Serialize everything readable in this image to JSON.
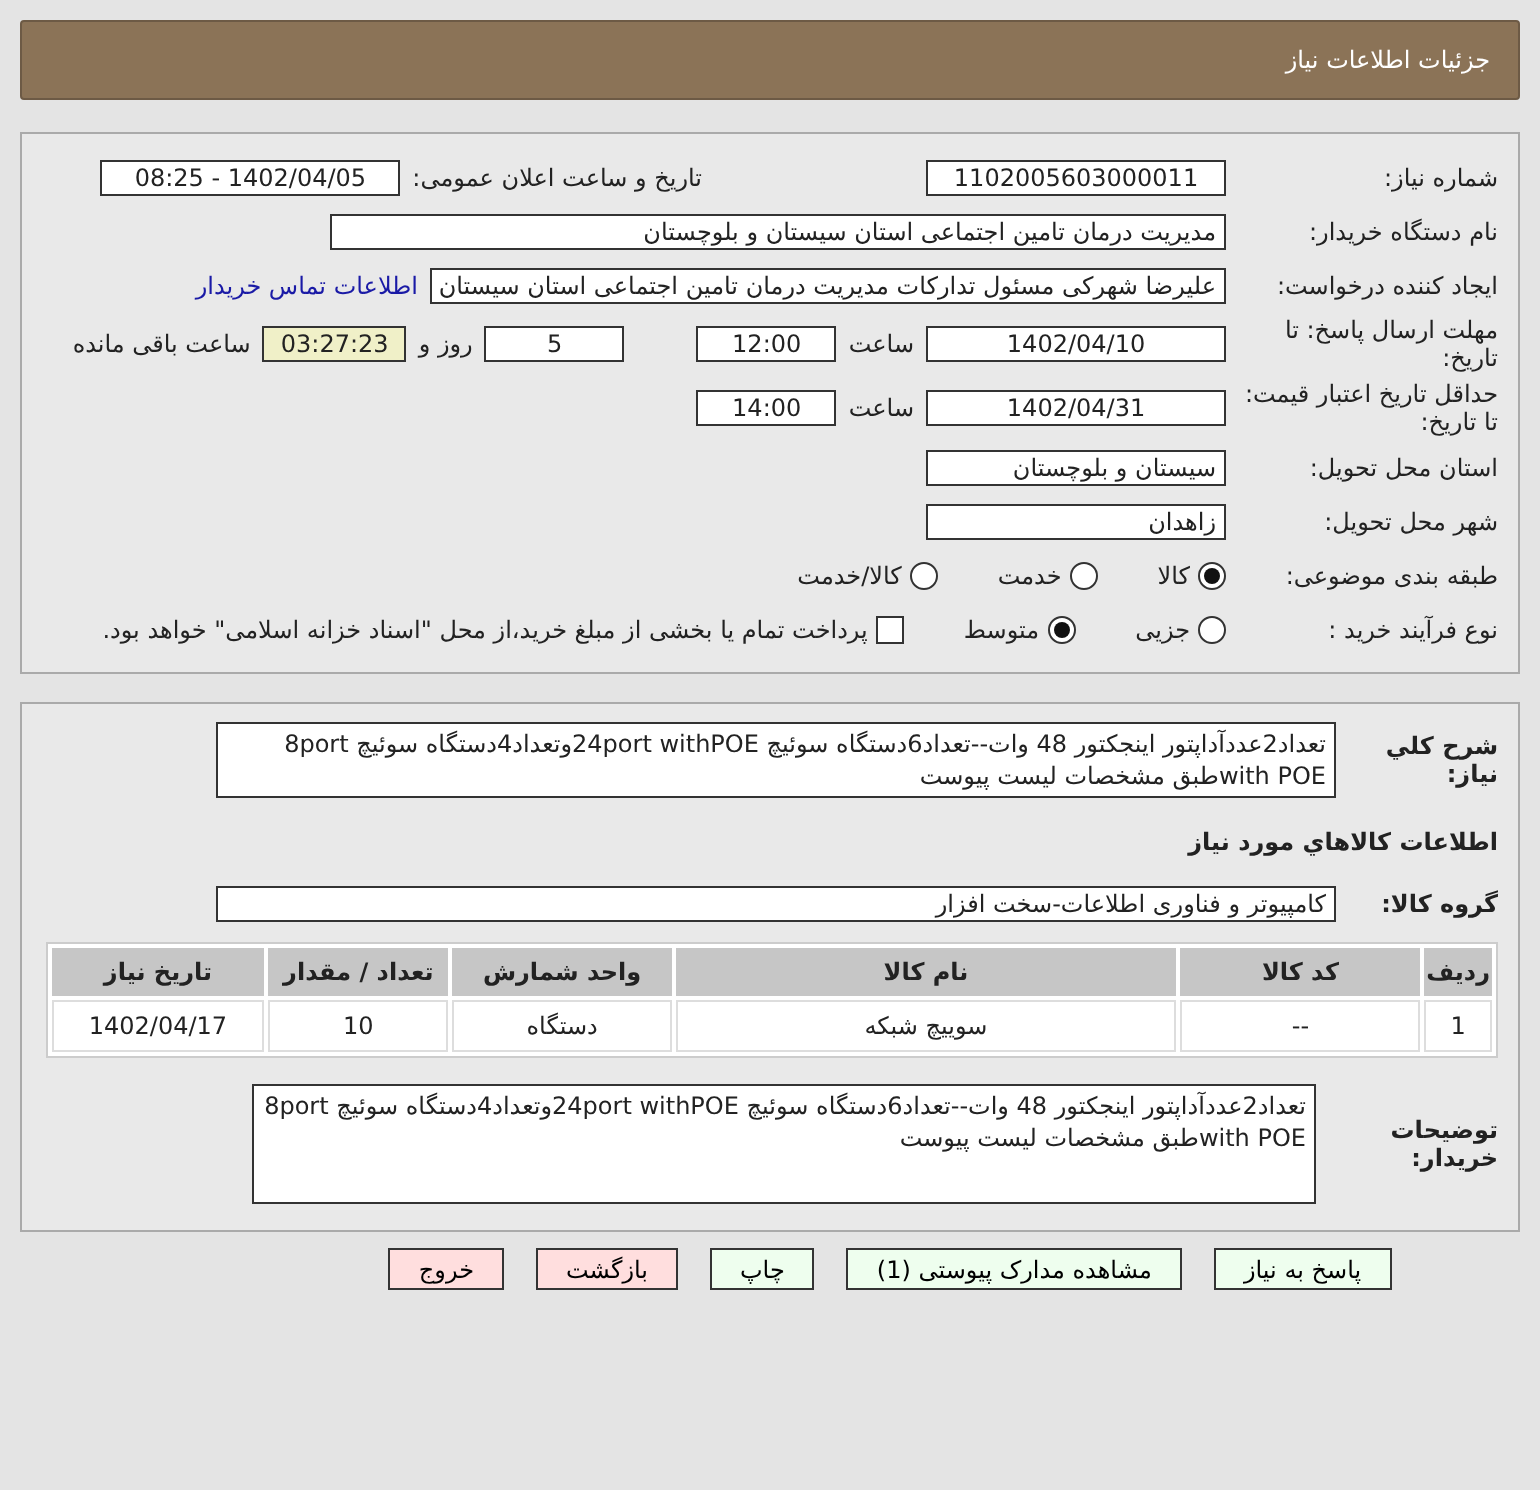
{
  "header": {
    "title": "جزئیات اطلاعات نیاز"
  },
  "need_number": {
    "label": "شماره نیاز:",
    "value": "1102005603000011"
  },
  "announce": {
    "label": "تاریخ و ساعت اعلان عمومی:",
    "value": "1402/04/05 - 08:25"
  },
  "buyer_org": {
    "label": "نام دستگاه خریدار:",
    "value": "مدیریت درمان تامین اجتماعی استان سیستان و بلوچستان"
  },
  "requester": {
    "label": "ایجاد کننده درخواست:",
    "value": "علیرضا شهرکی مسئول تدارکات مدیریت درمان تامین اجتماعی استان سیستان",
    "link": "اطلاعات تماس خریدار"
  },
  "deadline": {
    "label": "مهلت ارسال پاسخ: تا تاریخ:",
    "date": "1402/04/10",
    "time_label": "ساعت",
    "time": "12:00",
    "days": "5",
    "days_label": "روز و",
    "remaining": "03:27:23",
    "remaining_label": "ساعت باقی مانده"
  },
  "validity": {
    "label": "حداقل تاریخ اعتبار قیمت: تا تاریخ:",
    "date": "1402/04/31",
    "time_label": "ساعت",
    "time": "14:00"
  },
  "province": {
    "label": "استان محل تحویل:",
    "value": "سیستان و بلوچستان"
  },
  "city": {
    "label": "شهر محل تحویل:",
    "value": "زاهدان"
  },
  "category": {
    "label": "طبقه بندی موضوعی:",
    "options": [
      {
        "label": "کالا",
        "selected": true
      },
      {
        "label": "خدمت",
        "selected": false
      },
      {
        "label": "کالا/خدمت",
        "selected": false
      }
    ]
  },
  "process": {
    "label": "نوع فرآیند خرید :",
    "options": [
      {
        "label": "جزیی",
        "selected": false
      },
      {
        "label": "متوسط",
        "selected": true
      }
    ],
    "payment": {
      "label": "پرداخت تمام یا بخشی از مبلغ خرید،از محل \"اسناد خزانه اسلامی\" خواهد بود.",
      "checked": false
    }
  },
  "summary": {
    "label": "شرح کلي نياز:",
    "value": "تعداد2عددآداپتور اینجکتور 48 وات--تعداد6دستگاه سوئیچ 24port withPOEوتعداد4دستگاه سوئیچ 8port with POEطبق مشخصات لیست پیوست"
  },
  "goods_title": "اطلاعات کالاهاي مورد نياز",
  "goods_group": {
    "label": "گروه کالا:",
    "value": "کامپیوتر و فناوری اطلاعات-سخت افزار"
  },
  "table": {
    "columns": [
      "ردیف",
      "کد کالا",
      "نام کالا",
      "واحد شمارش",
      "تعداد / مقدار",
      "تاریخ نیاز"
    ],
    "rows": [
      [
        "1",
        "--",
        "سوییچ شبکه",
        "دستگاه",
        "10",
        "1402/04/17"
      ]
    ]
  },
  "buyer_notes": {
    "label": "توضیحات خریدار:",
    "value": "تعداد2عددآداپتور اینجکتور 48 وات--تعداد6دستگاه سوئیچ 24port withPOEوتعداد4دستگاه سوئیچ 8port with POEطبق مشخصات لیست پیوست"
  },
  "buttons": [
    {
      "label": "پاسخ به نیاز",
      "kind": "action"
    },
    {
      "label": "مشاهده مدارک پیوستی (1)",
      "kind": "action"
    },
    {
      "label": "چاپ",
      "kind": "action"
    },
    {
      "label": "بازگشت",
      "kind": "exit"
    },
    {
      "label": "خروج",
      "kind": "exit"
    }
  ]
}
